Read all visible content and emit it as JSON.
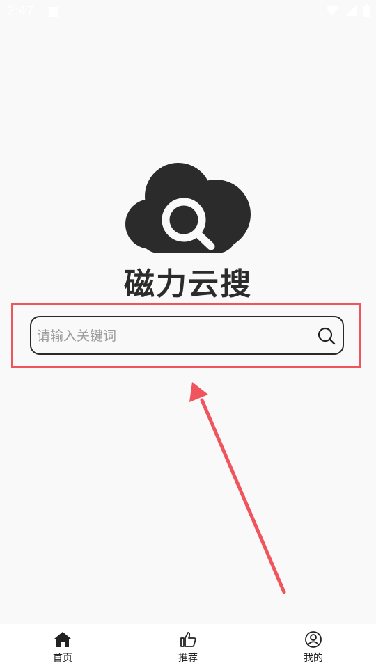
{
  "status_bar": {
    "time": "2:47",
    "icons": [
      "notification-icon",
      "wifi-icon",
      "signal-icon",
      "battery-icon"
    ]
  },
  "app": {
    "name": "磁力云搜",
    "logo": "cloud-search-logo"
  },
  "search": {
    "placeholder": "请输入关键词",
    "value": "",
    "icon": "search-icon"
  },
  "bottom_nav": {
    "items": [
      {
        "label": "首页",
        "icon": "home-icon"
      },
      {
        "label": "推荐",
        "icon": "thumbs-up-icon"
      },
      {
        "label": "我的",
        "icon": "user-icon"
      }
    ]
  },
  "annotation": {
    "highlight_color": "#f0545c",
    "arrow_color": "#f0545c"
  },
  "colors": {
    "background": "#f9f9f9",
    "logo": "#2b2b2b",
    "nav_background": "#ffffff"
  }
}
